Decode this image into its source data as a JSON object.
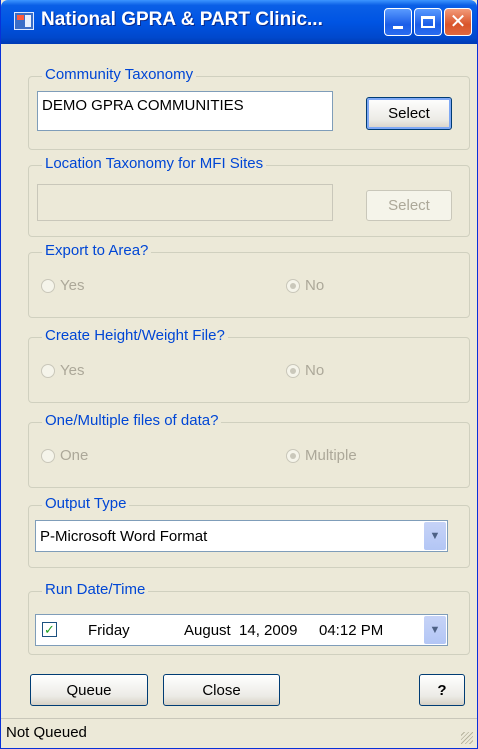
{
  "window": {
    "title": "National GPRA & PART Clinic..."
  },
  "community_taxonomy": {
    "legend": "Community Taxonomy",
    "value": "DEMO GPRA COMMUNITIES",
    "select_label": "Select"
  },
  "location_taxonomy": {
    "legend": "Location Taxonomy for MFI Sites",
    "value": "",
    "select_label": "Select"
  },
  "export_area": {
    "legend": "Export to Area?",
    "options": [
      "Yes",
      "No"
    ],
    "selected": "No"
  },
  "height_weight": {
    "legend": "Create Height/Weight File?",
    "options": [
      "Yes",
      "No"
    ],
    "selected": "No"
  },
  "files": {
    "legend": "One/Multiple files of data?",
    "options": [
      "One",
      "Multiple"
    ],
    "selected": "Multiple"
  },
  "output_type": {
    "legend": "Output Type",
    "value": "P-Microsoft Word Format"
  },
  "run_date": {
    "legend": "Run Date/Time",
    "checked": true,
    "weekday": "Friday",
    "date": "August  14, 2009",
    "time": "04:12 PM"
  },
  "buttons": {
    "queue": "Queue",
    "close": "Close",
    "help": "?"
  },
  "status": {
    "text": "Not Queued"
  }
}
